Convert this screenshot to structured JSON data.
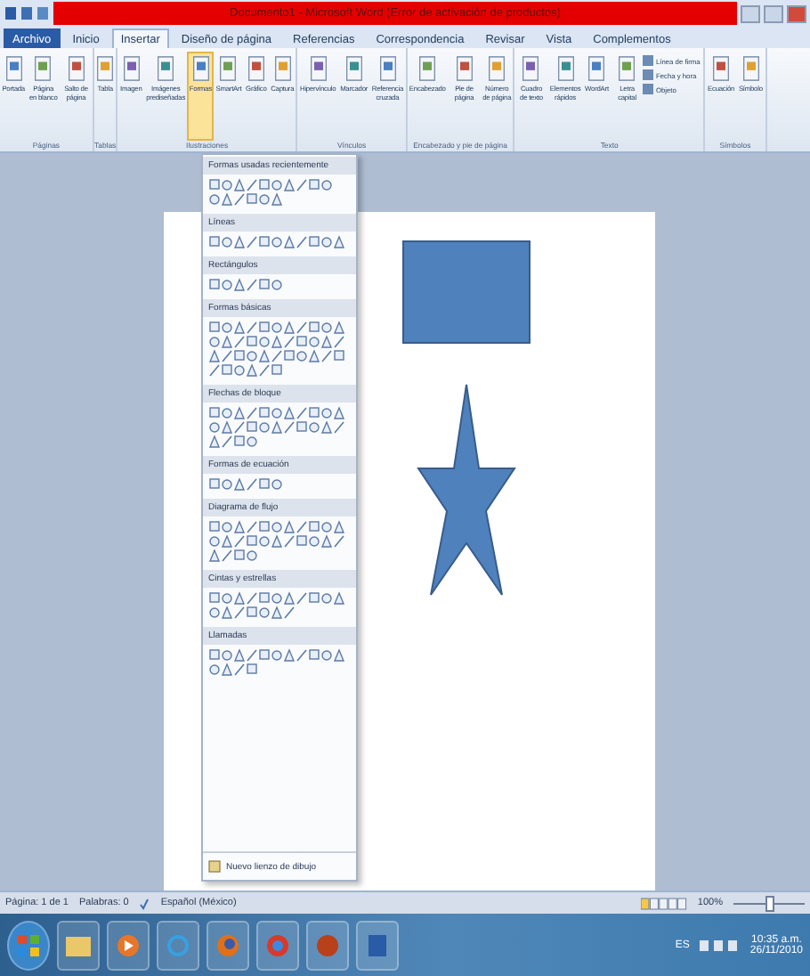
{
  "window": {
    "title": "Documento1 - Microsoft Word (Error de activación de productos)"
  },
  "tabs": [
    {
      "label": "Archivo",
      "kind": "file",
      "selected": false
    },
    {
      "label": "Inicio",
      "kind": "tab",
      "selected": false
    },
    {
      "label": "Insertar",
      "kind": "tab",
      "selected": true
    },
    {
      "label": "Diseño de página",
      "kind": "tab",
      "selected": false
    },
    {
      "label": "Referencias",
      "kind": "tab",
      "selected": false
    },
    {
      "label": "Correspondencia",
      "kind": "tab",
      "selected": false
    },
    {
      "label": "Revisar",
      "kind": "tab",
      "selected": false
    },
    {
      "label": "Vista",
      "kind": "tab",
      "selected": false
    },
    {
      "label": "Complementos",
      "kind": "tab",
      "selected": false
    }
  ],
  "ribbon_groups": [
    {
      "label": "Páginas",
      "buttons": [
        {
          "label": "Portada",
          "selected": false
        },
        {
          "label": "Página en blanco",
          "selected": false
        },
        {
          "label": "Salto de página",
          "selected": false
        }
      ]
    },
    {
      "label": "Tablas",
      "buttons": [
        {
          "label": "Tabla",
          "selected": false
        }
      ]
    },
    {
      "label": "Ilustraciones",
      "buttons": [
        {
          "label": "Imagen",
          "selected": false
        },
        {
          "label": "Imágenes prediseñadas",
          "selected": false
        },
        {
          "label": "Formas",
          "selected": true
        },
        {
          "label": "SmartArt",
          "selected": false
        },
        {
          "label": "Gráfico",
          "selected": false
        },
        {
          "label": "Captura",
          "selected": false
        }
      ]
    },
    {
      "label": "Vínculos",
      "buttons": [
        {
          "label": "Hipervínculo",
          "selected": false
        },
        {
          "label": "Marcador",
          "selected": false
        },
        {
          "label": "Referencia cruzada",
          "selected": false
        }
      ]
    },
    {
      "label": "Encabezado y pie de página",
      "buttons": [
        {
          "label": "Encabezado",
          "selected": false
        },
        {
          "label": "Pie de página",
          "selected": false
        },
        {
          "label": "Número de página",
          "selected": false
        }
      ]
    },
    {
      "label": "Texto",
      "buttons": [
        {
          "label": "Cuadro de texto",
          "selected": false
        },
        {
          "label": "Elementos rápidos",
          "selected": false
        },
        {
          "label": "WordArt",
          "selected": false
        },
        {
          "label": "Letra capital",
          "selected": false
        }
      ],
      "small_buttons": [
        "Línea de firma",
        "Fecha y hora",
        "Objeto"
      ]
    },
    {
      "label": "Símbolos",
      "buttons": [
        {
          "label": "Ecuación",
          "selected": false
        },
        {
          "label": "Símbolo",
          "selected": false
        }
      ]
    }
  ],
  "shapes_menu": {
    "sections": [
      {
        "title": "Formas usadas recientemente"
      },
      {
        "title": "Líneas"
      },
      {
        "title": "Rectángulos"
      },
      {
        "title": "Formas básicas"
      },
      {
        "title": "Flechas de bloque"
      },
      {
        "title": "Formas de ecuación"
      },
      {
        "title": "Diagrama de flujo"
      },
      {
        "title": "Cintas y estrellas"
      },
      {
        "title": "Llamadas"
      }
    ],
    "footer": "Nuevo lienzo de dibujo"
  },
  "status_bar": {
    "page": "Página: 1 de 1",
    "words": "Palabras: 0",
    "language": "Español (México)",
    "zoom": "100%",
    "zoom_slider": {
      "level": 0.5
    }
  },
  "taskbar": {
    "language": "ES",
    "time": "10:35 a.m.",
    "date": "26/11/2010"
  }
}
